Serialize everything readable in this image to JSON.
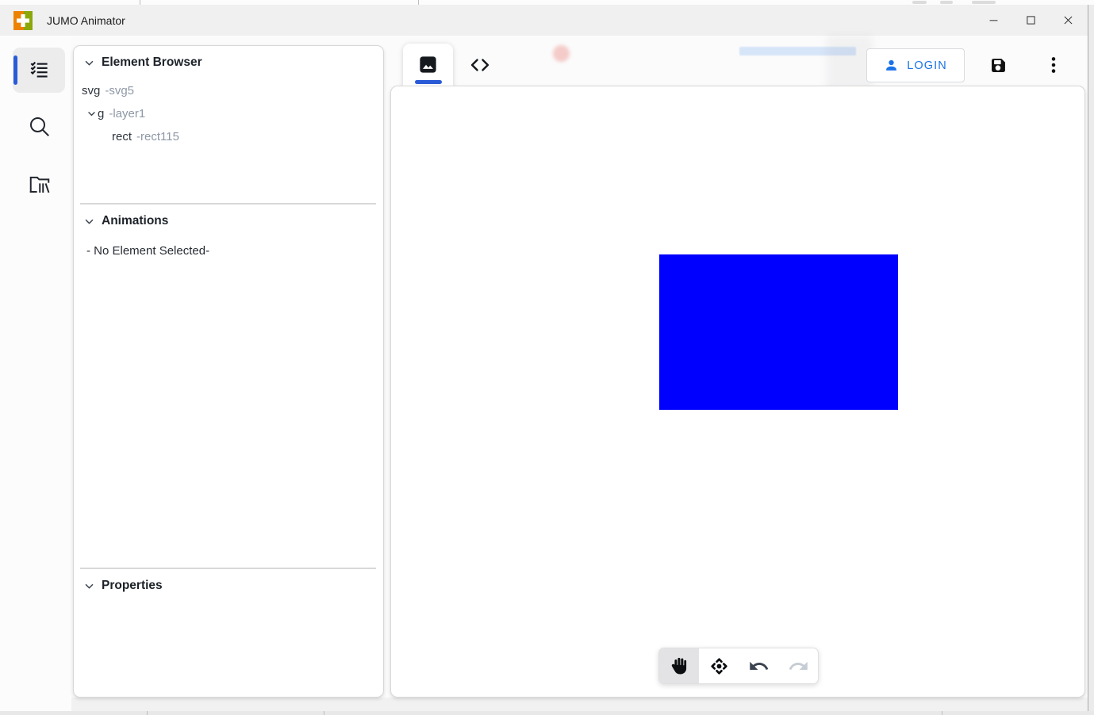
{
  "window": {
    "title": "JUMO Animator",
    "app_icon": "jumo-plus-logo",
    "controls": [
      {
        "icon": "minimize-icon"
      },
      {
        "icon": "maximize-icon"
      },
      {
        "icon": "close-icon"
      }
    ]
  },
  "activity_bar": {
    "items": [
      {
        "icon": "checklist-icon",
        "name": "element-list",
        "selected": true
      },
      {
        "icon": "search-icon",
        "name": "search",
        "selected": false
      },
      {
        "icon": "library-icon",
        "name": "file-library",
        "selected": false
      }
    ]
  },
  "element_browser": {
    "title": "Element Browser",
    "tree": [
      {
        "tag": "svg",
        "id": "-svg5",
        "indent": 0,
        "expanded": false
      },
      {
        "tag": "g",
        "id": "-layer1",
        "indent": 1,
        "expanded": true
      },
      {
        "tag": "rect",
        "id": "-rect115",
        "indent": 2,
        "expanded": false
      }
    ]
  },
  "animations": {
    "title": "Animations",
    "empty_text": "- No Element Selected-"
  },
  "properties": {
    "title": "Properties"
  },
  "editor": {
    "tabs": [
      {
        "icon": "image-icon",
        "name": "design-view",
        "selected": true
      },
      {
        "icon": "code-icon",
        "name": "code-view",
        "selected": false
      }
    ],
    "login_label": "LOGIN",
    "actions": [
      {
        "icon": "save-icon"
      },
      {
        "icon": "kebab-menu-icon"
      }
    ]
  },
  "canvas": {
    "shape": {
      "type": "rect",
      "fill": "#0000FF"
    }
  },
  "toolbar": {
    "tools": [
      {
        "icon": "hand-icon",
        "name": "pan",
        "selected": true,
        "disabled": false
      },
      {
        "icon": "move-icon",
        "name": "move",
        "selected": false,
        "disabled": false
      },
      {
        "icon": "undo-icon",
        "name": "undo",
        "selected": false,
        "disabled": false
      },
      {
        "icon": "redo-icon",
        "name": "redo",
        "selected": false,
        "disabled": true
      }
    ]
  },
  "colors": {
    "accent_blue": "#2a5bd7",
    "login_blue": "#1a73e8",
    "rect_fill": "#0000FF",
    "titlebar_bg": "#f0f0f0"
  }
}
